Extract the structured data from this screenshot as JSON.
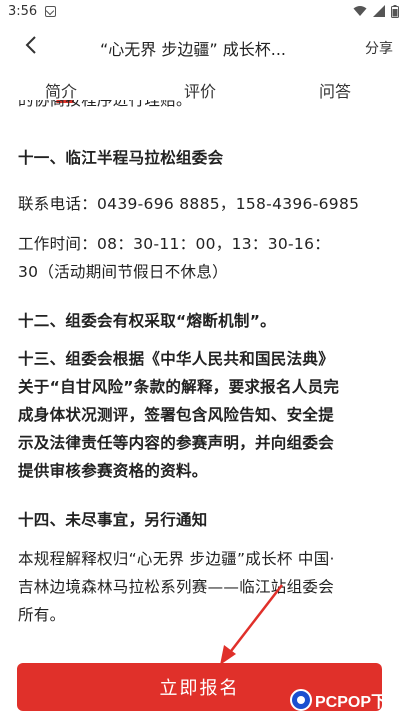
{
  "status_bar": {
    "time": "3:56"
  },
  "nav": {
    "title": "“心无界 步边疆” 成长杯...",
    "share_label": "分享"
  },
  "tabs": [
    {
      "label": "简介",
      "active": true
    },
    {
      "label": "评价",
      "active": false
    },
    {
      "label": "问答",
      "active": false
    }
  ],
  "content": {
    "cut_line": "的协商按程序进行理赔。",
    "section_11_heading": "十一、临江半程马拉松组委会",
    "contact_phone": "联系电话：0439-696 8885，158-4396-6985",
    "work_hours_line1": "工作时间：08：30-11：00，13：30-16：",
    "work_hours_line2": "30（活动期间节假日不休息）",
    "section_12": "十二、组委会有权采取“熔断机制”。",
    "section_13_line1": "十三、组委会根据《中华人民共和国民法典》",
    "section_13_line2": "关于“自甘风险”条款的解释，要求报名人员完",
    "section_13_line3": "成身体状况测评，签署包含风险告知、安全提",
    "section_13_line4": "示及法律责任等内容的参赛声明，并向组委会",
    "section_13_line5": "提供审核参赛资格的资料。",
    "section_14": "十四、未尽事宜，另行通知",
    "final_line1": "本规程解释权归“心无界 步边疆”成长杯 中国·",
    "final_line2": "吉林边境森林马拉松系列赛——临江站组委会",
    "final_line3": "所有。"
  },
  "register_button_label": "立即报名",
  "watermark": {
    "text": "PCPOP下载"
  },
  "colors": {
    "accent": "#e0302a",
    "text": "#222222"
  }
}
